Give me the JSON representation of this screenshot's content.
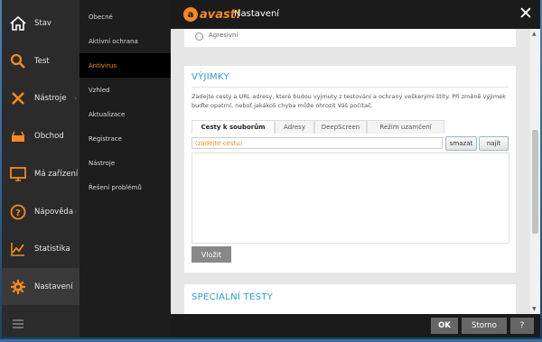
{
  "app": {
    "logo_text": "avast!",
    "logo_mark": "a",
    "title": "Nastavení",
    "close_glyph": "✕"
  },
  "nav": [
    {
      "label": "Stav",
      "icon": "home-icon"
    },
    {
      "label": "Test",
      "icon": "magnifier-icon"
    },
    {
      "label": "Nástroje",
      "icon": "tools-icon",
      "submenu": true
    },
    {
      "label": "Obchod",
      "icon": "shop-icon"
    },
    {
      "label": "Má zařízení",
      "icon": "monitor-icon"
    },
    {
      "label": "Nápověda",
      "icon": "help-icon",
      "submenu": true
    },
    {
      "label": "Statistika",
      "icon": "stats-icon"
    },
    {
      "label": "Nastavení",
      "icon": "settings-gear-icon",
      "active": true
    }
  ],
  "nav_menu_icon": "hamburger-menu-icon",
  "submenu": [
    "Obecné",
    "Aktivní ochrana",
    "Antivirus",
    "Vzhled",
    "Aktualizace",
    "Registrace",
    "Nástroje",
    "Řešení problémů"
  ],
  "submenu_active_index": 2,
  "top_section": {
    "radio_label": "Agresivní"
  },
  "exceptions": {
    "title": "VÝJIMKY",
    "description": "Zadejte cesty a URL adresy, které budou vyjmuty z testování a ochrany veškerými štíty. Při změně výjimek buďte opatrní, neboť jakákoli chyba může ohrozit Váš počítač.",
    "tabs": [
      "Cesty k souborům",
      "Adresy",
      "DeepScreen",
      "Režim uzamčení"
    ],
    "active_tab": 0,
    "path_placeholder": "(zadejte cestu)",
    "delete_label": "smazat",
    "find_label": "najít",
    "insert_label": "Vložit"
  },
  "special_tests": {
    "title": "SPECIÁLNÍ TESTY"
  },
  "footer": {
    "ok_label": "OK",
    "cancel_label": "Storno",
    "help_label": "?"
  },
  "colors": {
    "accent": "#f58a1f",
    "link_blue": "#2c9ed6",
    "dark": "#1b1b1b"
  }
}
